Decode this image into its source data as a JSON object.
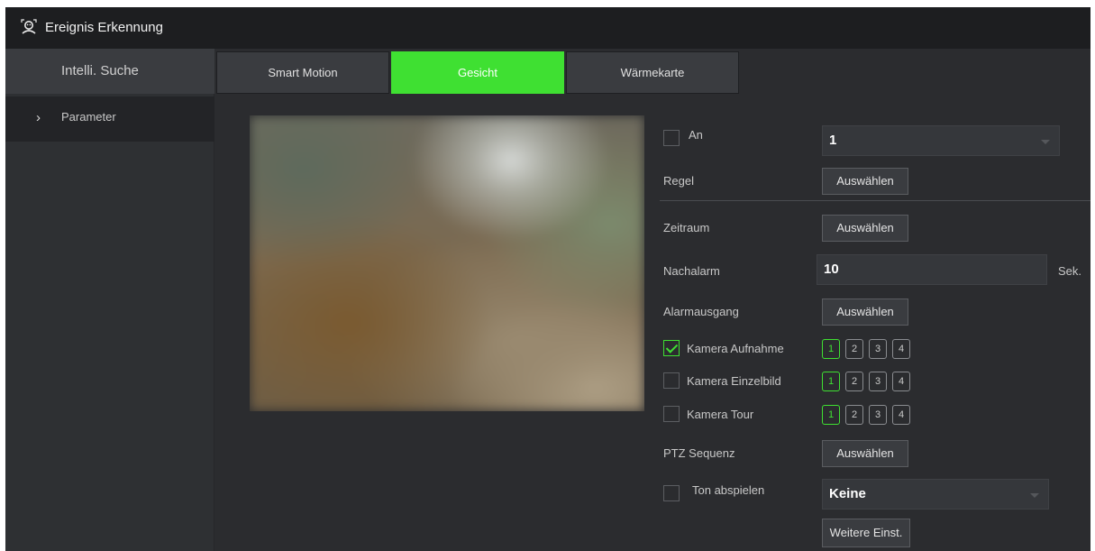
{
  "window": {
    "title": "Ereignis Erkennung",
    "icon": "face-detect-icon"
  },
  "sidebar": {
    "items": [
      {
        "label": "Intelli. Suche"
      },
      {
        "label": "Parameter",
        "chevron": "›"
      }
    ]
  },
  "tabs": [
    {
      "label": "Smart Motion"
    },
    {
      "label": "Gesicht",
      "active": true
    },
    {
      "label": "Wärmekarte"
    }
  ],
  "form": {
    "an": {
      "label": "An",
      "checked": false,
      "select_value": "1"
    },
    "regel": {
      "label": "Regel",
      "button": "Auswählen"
    },
    "zeitraum": {
      "label": "Zeitraum",
      "button": "Auswählen"
    },
    "nachalarm": {
      "label": "Nachalarm",
      "value": "10",
      "unit": "Sek."
    },
    "alarmausgang": {
      "label": "Alarmausgang",
      "button": "Auswählen"
    },
    "kamera_aufnahme": {
      "label": "Kamera Aufnahme",
      "checked": true,
      "channels": [
        "1",
        "2",
        "3",
        "4"
      ],
      "selected": [
        "1"
      ]
    },
    "kamera_einzelbild": {
      "label": "Kamera Einzelbild",
      "checked": false,
      "channels": [
        "1",
        "2",
        "3",
        "4"
      ],
      "selected": [
        "1"
      ]
    },
    "kamera_tour": {
      "label": "Kamera Tour",
      "checked": false,
      "channels": [
        "1",
        "2",
        "3",
        "4"
      ],
      "selected": [
        "1"
      ]
    },
    "ptz_sequenz": {
      "label": "PTZ Sequenz",
      "button": "Auswählen"
    },
    "ton_abspielen": {
      "label": "Ton abspielen",
      "checked": false,
      "select_value": "Keine"
    },
    "weitere": {
      "button": "Weitere Einst."
    }
  },
  "colors": {
    "accent": "#3fe032",
    "background": "#2b2c2f",
    "titlebar": "#1d1e20"
  }
}
